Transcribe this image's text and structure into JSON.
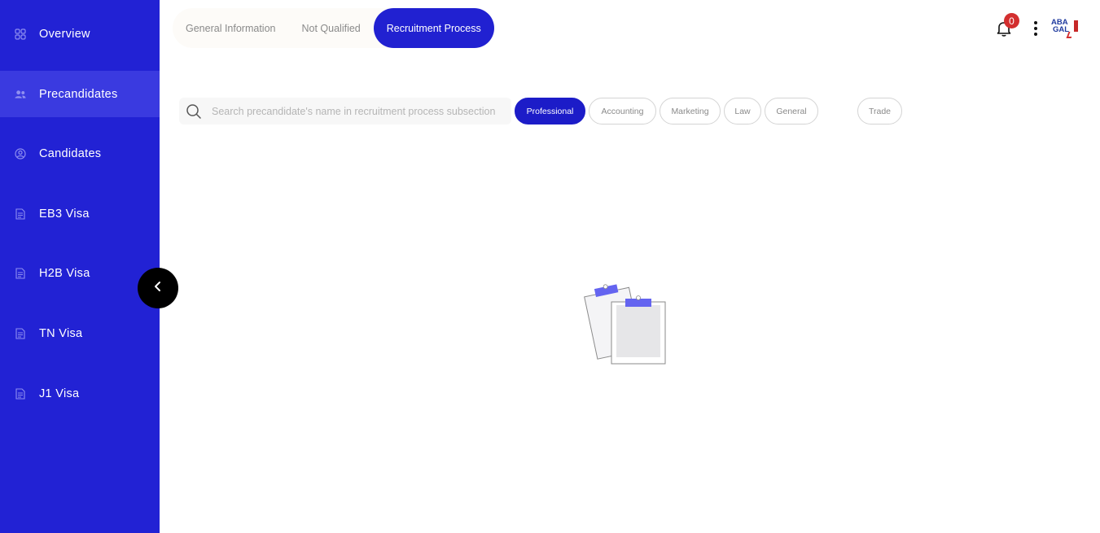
{
  "sidebar": {
    "items": [
      {
        "label": "Overview",
        "icon": "grid-icon"
      },
      {
        "label": "Precandidates",
        "icon": "users-icon",
        "active": true
      },
      {
        "label": "Candidates",
        "icon": "user-circle-icon"
      },
      {
        "label": "EB3 Visa",
        "icon": "document-icon"
      },
      {
        "label": "H2B Visa",
        "icon": "document-icon"
      },
      {
        "label": "TN Visa",
        "icon": "document-icon"
      },
      {
        "label": "J1 Visa",
        "icon": "document-icon"
      }
    ],
    "collapse_icon": "chevron-left-icon"
  },
  "tabs": [
    {
      "label": "General Information"
    },
    {
      "label": "Not Qualified"
    },
    {
      "label": "Recruitment Process",
      "active": true
    }
  ],
  "header": {
    "notifications_count": "0",
    "bell_icon": "bell-icon",
    "menu_icon": "more-vertical-icon",
    "logo_text_line1": "ABA",
    "logo_text_line2": "GAL"
  },
  "search": {
    "placeholder": "Search precandidate's name in recruitment process subsection",
    "value": "",
    "icon": "search-icon"
  },
  "filters": [
    {
      "label": "Professional",
      "active": true
    },
    {
      "label": "Accounting"
    },
    {
      "label": "Marketing"
    },
    {
      "label": "Law"
    },
    {
      "label": "General"
    },
    {
      "label": "Trade"
    }
  ],
  "empty_state": {
    "icon": "clipboard-empty-icon"
  },
  "colors": {
    "sidebar_bg": "#2222d4",
    "accent": "#2121d1",
    "badge": "#d32f2f"
  }
}
